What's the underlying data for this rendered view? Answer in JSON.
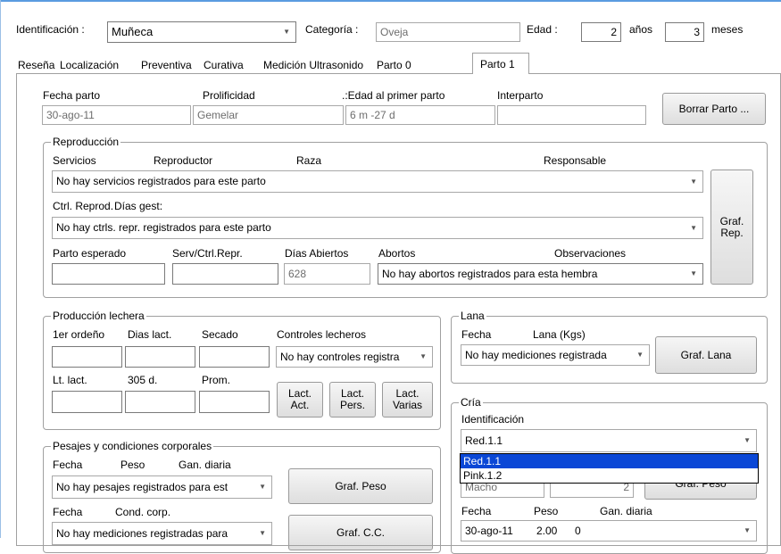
{
  "header": {
    "identificacion_label": "Identificación :",
    "identificacion_value": "Muñeca",
    "categoria_label": "Categoría :",
    "categoria_value": "Oveja",
    "edad_label": "Edad :",
    "edad_years": "2",
    "years_label": "años",
    "edad_months": "3",
    "months_label": "meses"
  },
  "tabs": [
    "Reseña",
    "Localización",
    "Preventiva",
    "Curativa",
    "Medición Ultrasonido",
    "Parto 0",
    "Parto 1"
  ],
  "active_tab": "Parto 1",
  "parto": {
    "fecha_label": "Fecha parto",
    "fecha_value": "30-ago-11",
    "prolificidad_label": "Prolificidad",
    "prolificidad_value": "Gemelar",
    "edad_primer_label": ".:Edad al primer parto",
    "edad_primer_value": "6 m -27 d",
    "interparto_label": "Interparto",
    "interparto_value": "",
    "borrar_button": "Borrar Parto ..."
  },
  "reproduccion": {
    "title": "Reproducción",
    "col_servicios": "Servicios",
    "col_reproductor": "Reproductor",
    "col_raza": "Raza",
    "col_responsable": "Responsable",
    "servicios_combo": "No hay servicios registrados para este parto",
    "ctrl_label": "Ctrl. Reprod.",
    "dias_gest_label": "Días gest:",
    "ctrl_combo": "No hay ctrls. repr. registrados para este parto",
    "parto_esperado_label": "Parto esperado",
    "serv_ctrl_label": "Serv/Ctrl.Repr.",
    "dias_abiertos_label": "Días Abiertos",
    "dias_abiertos_value": "628",
    "abortos_label": "Abortos",
    "observaciones_label": "Observaciones",
    "abortos_combo": "No hay abortos registrados para esta hembra",
    "graf_rep_button": "Graf. Rep."
  },
  "produccion": {
    "title": "Producción lechera",
    "primer_ordeno_label": "1er ordeño",
    "dias_lact_label": "Dias lact.",
    "secado_label": "Secado",
    "controles_label": "Controles  lecheros",
    "controles_combo": "No hay controles registra",
    "lt_lact_label": "Lt. lact.",
    "d305_label": "305 d.",
    "prom_label": "Prom.",
    "lact_act_button": "Lact. Act.",
    "lact_pers_button": "Lact. Pers.",
    "lact_varias_button": "Lact. Varias"
  },
  "lana": {
    "title": "Lana",
    "fecha_label": "Fecha",
    "lana_kgs_label": "Lana (Kgs)",
    "mediciones_combo": "No hay mediciones registrada",
    "graf_lana_button": "Graf. Lana"
  },
  "pesajes": {
    "title": "Pesajes y condiciones corporales",
    "fecha_label": "Fecha",
    "peso_label": "Peso",
    "gan_diaria_label": "Gan. diaria",
    "pesajes_combo": "No hay pesajes registrados para est",
    "graf_peso_button": "Graf. Peso",
    "fecha2_label": "Fecha",
    "cond_corp_label": "Cond. corp.",
    "mediciones_combo": "No hay mediciones registradas para",
    "graf_cc_button": "Graf. C.C."
  },
  "cria": {
    "title": "Cría",
    "identificacion_label": "Identificación",
    "identificacion_combo": "Red.1.1",
    "dropdown_options": [
      "Red.1.1",
      "Pink.1.2"
    ],
    "dropdown_selected": "Red.1.1",
    "sexo_value": "Macho",
    "numero_value": "2",
    "graf_peso_button": "Graf. Peso",
    "fecha_label": "Fecha",
    "peso_label": "Peso",
    "gan_diaria_label": "Gan. diaria",
    "pesaje_fecha": "30-ago-11",
    "pesaje_peso": "2.00",
    "pesaje_gan": "0"
  }
}
